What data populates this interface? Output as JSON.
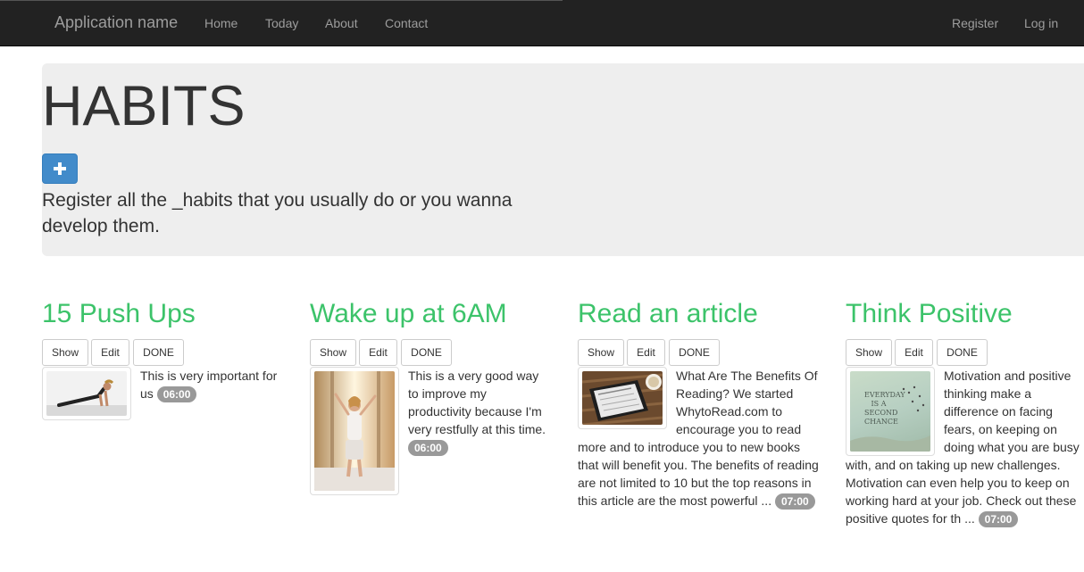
{
  "navbar": {
    "brand": "Application name",
    "links": [
      "Home",
      "Today",
      "About",
      "Contact"
    ],
    "right_links": [
      "Register",
      "Log in"
    ]
  },
  "jumbotron": {
    "title": "HABITS",
    "add_icon": "plus-icon",
    "description": "Register all the _habits that you usually do or you wanna develop them."
  },
  "habits": [
    {
      "title": "15 Push Ups",
      "buttons": [
        "Show",
        "Edit",
        "DONE"
      ],
      "image": "push-up-photo",
      "description": "This is very important for us",
      "time": "06:00"
    },
    {
      "title": "Wake up at 6AM",
      "buttons": [
        "Show",
        "Edit",
        "DONE"
      ],
      "image": "morning-stretch-photo",
      "description": "This is a very good way to improve my productivity because I'm very restfully at this time.",
      "time": "06:00"
    },
    {
      "title": "Read an article",
      "buttons": [
        "Show",
        "Edit",
        "DONE"
      ],
      "image": "tablet-reading-photo",
      "description": "What Are The Benefits Of Reading? We started WhytoRead.com to encourage you to read more and to introduce you to new books that will benefit you. The benefits of reading are not limited to 10 but the top reasons in this article are the most powerful ...",
      "time": "07:00"
    },
    {
      "title": "Think Positive",
      "buttons": [
        "Show",
        "Edit",
        "DONE"
      ],
      "image": "motivational-quote-photo",
      "image_caption": "EVERYDAY IS A SECOND CHANCE",
      "description": "Motivation and positive thinking make a difference on facing fears, on keeping on doing what you are busy with, and on taking up new challenges. Motivation can even help you to keep on working hard at your job. Check out these positive quotes for th ...",
      "time": "07:00"
    }
  ],
  "colors": {
    "navbar_bg": "#222222",
    "habit_title": "#3cc36a",
    "primary_button": "#428bca",
    "jumbotron_bg": "#eeeeee",
    "badge_bg": "#999999"
  }
}
